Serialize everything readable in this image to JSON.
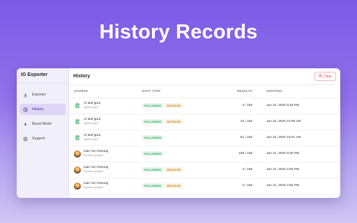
{
  "hero": {
    "title": "History Records"
  },
  "app": {
    "name": "IG Exporter"
  },
  "sidebar": {
    "items": [
      {
        "label": "Exporter",
        "icon": "download-icon"
      },
      {
        "label": "History",
        "icon": "clock-icon",
        "active": true
      },
      {
        "label": "Boost Mode",
        "icon": "bolt-icon"
      },
      {
        "label": "Support",
        "icon": "help-icon"
      }
    ]
  },
  "main": {
    "title": "History",
    "clear_label": "Clear",
    "columns": {
      "source": "SOURCE",
      "data_type": "DATA TYPE",
      "results": "RESULTS",
      "updated": "UPDATED ↓"
    }
  },
  "rows": [
    {
      "name": "Ai tool guru",
      "handle": "@aitool.guru",
      "icon": "ig-icon",
      "tags": [
        "FOLLOWING",
        "DETAILED"
      ],
      "results": "4 / 155",
      "updated": "Jan 22, 2025 8:25 PM"
    },
    {
      "name": "Ai tool guru",
      "handle": "@aitool.guru",
      "icon": "ig-icon",
      "tags": [
        "FOLLOWING",
        "DETAILED"
      ],
      "results": "15 / 155",
      "updated": "Jan 22, 2025 10:06 AM"
    },
    {
      "name": "Ai tool guru",
      "handle": "@aitool.guru",
      "icon": "ig-icon",
      "tags": [
        "FOLLOWING"
      ],
      "results": "61 / 155",
      "updated": "Jan 22, 2025 10:01 AM"
    },
    {
      "name": "Gan Yin Choong",
      "handle": "@adam.goldgrid",
      "icon": "avatar",
      "tags": [
        "FOLLOWING"
      ],
      "results": "159 / 159",
      "updated": "Jan 21, 2025 9:30 PM"
    },
    {
      "name": "Gan Yin Choong",
      "handle": "@adam.goldgrid",
      "icon": "avatar",
      "tags": [
        "FOLLOWING",
        "DETAILED"
      ],
      "results": "4 / 159",
      "updated": "Jan 21, 2025 4:56 PM"
    },
    {
      "name": "Gan Yin Choong",
      "handle": "@adam.goldgrid",
      "icon": "avatar",
      "tags": [
        "FOLLOWING",
        "DETAILED"
      ],
      "results": "2 / 155",
      "updated": "Jan 21, 2025 4:55 PM"
    }
  ],
  "colors": {
    "accent": "#7b5ae6",
    "active_nav": "#ddd6f7",
    "following": "#2a9a4f",
    "detailed": "#c87a12",
    "danger": "#e04a4a"
  }
}
